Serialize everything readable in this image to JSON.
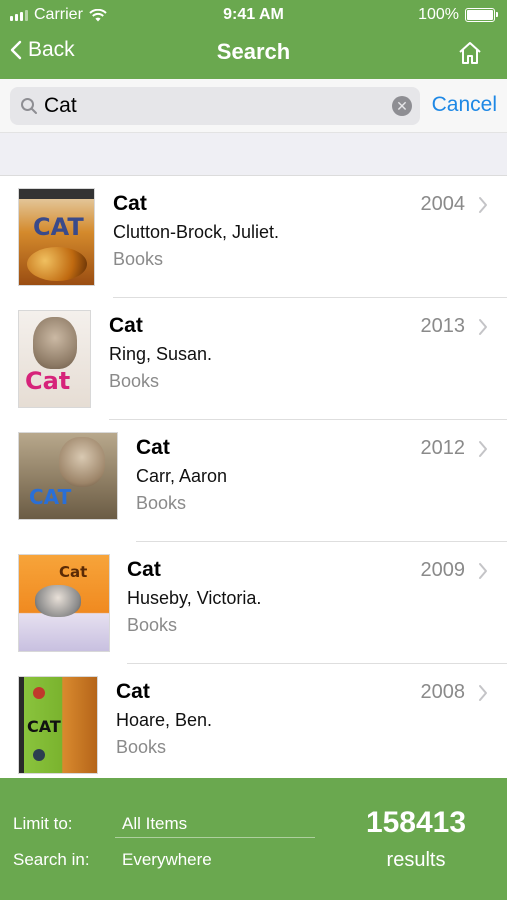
{
  "status_bar": {
    "carrier": "Carrier",
    "time": "9:41 AM",
    "battery": "100%"
  },
  "nav": {
    "back_label": "Back",
    "title": "Search",
    "home_icon": "home-icon"
  },
  "search": {
    "value": "Cat",
    "placeholder": "",
    "cancel_label": "Cancel"
  },
  "results": [
    {
      "title": "Cat",
      "author": "Clutton-Brock, Juliet.",
      "type": "Books",
      "year": "2004",
      "cover_text": "CAT",
      "cover_color": "#c96a1c"
    },
    {
      "title": "Cat",
      "author": "Ring, Susan.",
      "type": "Books",
      "year": "2013",
      "cover_text": "Cat",
      "cover_color": "#e8e4e0"
    },
    {
      "title": "Cat",
      "author": "Carr, Aaron",
      "type": "Books",
      "year": "2012",
      "cover_text": "CAT",
      "cover_color": "#9a8a70"
    },
    {
      "title": "Cat",
      "author": "Huseby, Victoria.",
      "type": "Books",
      "year": "2009",
      "cover_text": "Cat",
      "cover_color": "#f29a2e"
    },
    {
      "title": "Cat",
      "author": "Hoare, Ben.",
      "type": "Books",
      "year": "2008",
      "cover_text": "CAT",
      "cover_color": "#8cc63f"
    }
  ],
  "footer": {
    "limit_label": "Limit to:",
    "limit_value": "All Items",
    "search_in_label": "Search in:",
    "search_in_value": "Everywhere",
    "count": "158413",
    "count_label": "results"
  },
  "colors": {
    "brand_green": "#6aa84f",
    "link_blue": "#1e88e5"
  }
}
